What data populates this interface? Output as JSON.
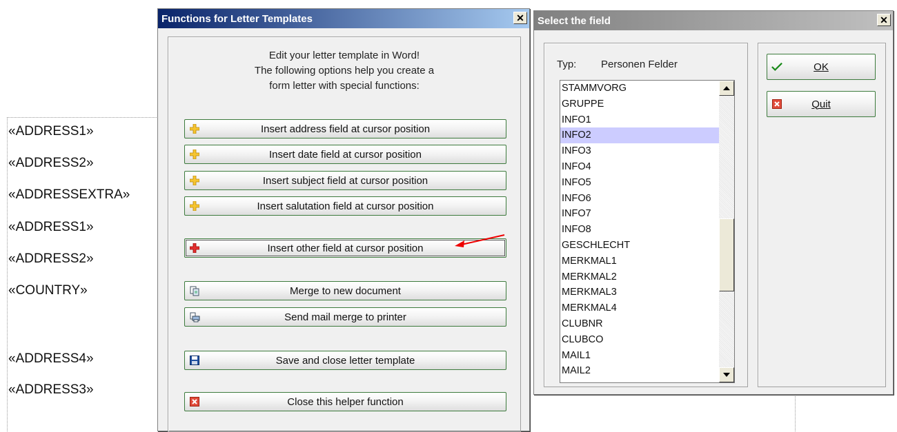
{
  "document": {
    "fields": [
      "«ADDRESS1»",
      "«ADDRESS2»",
      "«ADDRESSEXTRA»",
      "«ADDRESS1»",
      "«ADDRESS2»",
      "«COUNTRY»",
      "«ADDRESS4»",
      "«ADDRESS3»"
    ]
  },
  "functions_dialog": {
    "title": "Functions for Letter Templates",
    "close_label": "x",
    "intro_lines": [
      "Edit your letter template in Word!",
      "The following options help you create a",
      "form letter with special functions:"
    ],
    "buttons": {
      "insert_address": "Insert address field at cursor position",
      "insert_date": "Insert date field at cursor position",
      "insert_subject": "Insert subject field at cursor position",
      "insert_salutation": "Insert salutation field at cursor position",
      "insert_other": "Insert other field at cursor position",
      "merge_new": "Merge to new document",
      "send_printer": "Send mail merge to printer",
      "save_close": "Save and close letter template",
      "close_helper": "Close this helper function"
    }
  },
  "select_dialog": {
    "title": "Select the field",
    "close_label": "x",
    "typ_label": "Typ:",
    "typ_value": "Personen Felder",
    "items": [
      "STAMMVORG",
      "GRUPPE",
      "INFO1",
      "INFO2",
      "INFO3",
      "INFO4",
      "INFO5",
      "INFO6",
      "INFO7",
      "INFO8",
      "GESCHLECHT",
      "MERKMAL1",
      "MERKMAL2",
      "MERKMAL3",
      "MERKMAL4",
      "CLUBNR",
      "CLUBCO",
      "MAIL1",
      "MAIL2"
    ],
    "selected_item": "INFO2",
    "ok_label": "OK",
    "quit_label": "Quit"
  },
  "colors": {
    "title_active": "#0a246a",
    "title_inactive": "#808080",
    "selection": "#ccccff",
    "button_border": "#3c7a3c"
  }
}
